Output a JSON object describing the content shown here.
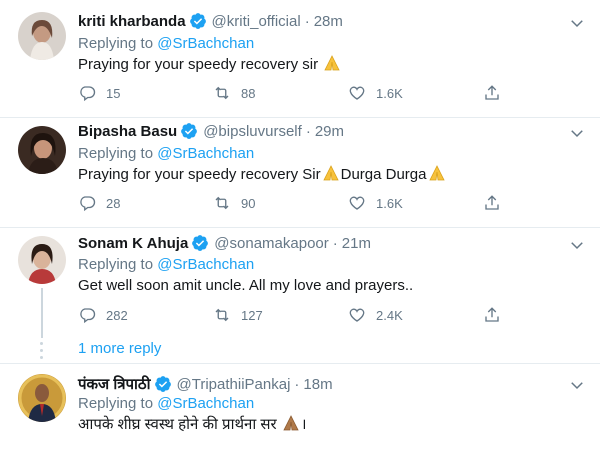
{
  "tweets": [
    {
      "name": "kriti kharbanda",
      "handle": "@kriti_official",
      "separator": "·",
      "time": "28m",
      "replying_prefix": "Replying to",
      "replying_to": "@SrBachchan",
      "text": "Praying for your speedy recovery sir",
      "text_after": "",
      "replies": "15",
      "retweets": "88",
      "likes": "1.6K"
    },
    {
      "name": "Bipasha Basu",
      "handle": "@bipsluvurself",
      "separator": "·",
      "time": "29m",
      "replying_prefix": "Replying to",
      "replying_to": "@SrBachchan",
      "text": "Praying for your speedy recovery Sir",
      "text_after": "Durga Durga",
      "replies": "28",
      "retweets": "90",
      "likes": "1.6K"
    },
    {
      "name": "Sonam K Ahuja",
      "handle": "@sonamakapoor",
      "separator": "·",
      "time": "21m",
      "replying_prefix": "Replying to",
      "replying_to": "@SrBachchan",
      "text": "Get well soon amit uncle. All my love and prayers..",
      "text_after": "",
      "replies": "282",
      "retweets": "127",
      "likes": "2.4K",
      "more_replies": "1 more reply"
    },
    {
      "name": "पंकज त्रिपाठी",
      "handle": "@TripathiiPankaj",
      "separator": "·",
      "time": "18m",
      "replying_prefix": "Replying to",
      "replying_to": "@SrBachchan",
      "text": "आपके शीघ्र स्वस्थ होने  की प्रार्थना सर",
      "text_after": "।"
    }
  ],
  "icons": {
    "verified": "verified-badge-icon",
    "reply": "reply-icon",
    "retweet": "retweet-icon",
    "like": "heart-icon",
    "share": "share-icon",
    "more": "chevron-down-icon",
    "emoji": "folded-hands-icon"
  },
  "colors": {
    "link": "#1da1f2",
    "muted": "#657786",
    "text": "#14171a",
    "divider": "#e6ecf0"
  }
}
